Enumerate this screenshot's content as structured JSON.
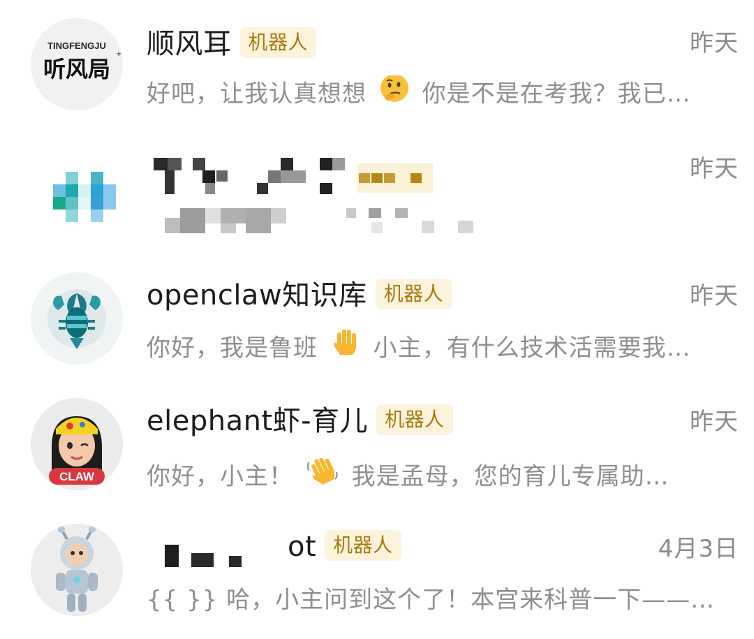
{
  "chats": [
    {
      "name": "顺风耳",
      "badge": "机器人",
      "time": "昨天",
      "preview_before": "好吧，让我认真想想",
      "preview_emoji": "thinking-face-icon",
      "preview_after": "你是不是在考我？我已…",
      "avatar": {
        "kind": "logo",
        "top_text": "TINGFENGJU",
        "main_text": "听风局"
      }
    },
    {
      "name": "",
      "badge": "",
      "time": "昨天",
      "preview_before": "",
      "preview_emoji": "",
      "preview_after": "",
      "avatar": {
        "kind": "pixelated"
      }
    },
    {
      "name": "openclaw知识库",
      "badge": "机器人",
      "time": "昨天",
      "preview_before": "你好，我是鲁班",
      "preview_emoji": "raised-hand-icon",
      "preview_after": "小主，有什么技术活需要我…",
      "avatar": {
        "kind": "lobster"
      }
    },
    {
      "name": "elephant虾-育儿",
      "badge": "机器人",
      "time": "昨天",
      "preview_before": "你好，小主！",
      "preview_emoji": "waving-hand-icon",
      "preview_after": "我是孟母，您的育儿专属助…",
      "avatar": {
        "kind": "girl",
        "label": "CLAW"
      }
    },
    {
      "name_suffix": "ot",
      "badge": "机器人",
      "time": "4月3日",
      "preview_before": "{{ }} 哈，小主问到这个了！本宫来科普一下——…",
      "avatar": {
        "kind": "robot"
      }
    }
  ],
  "colors": {
    "badge_bg": "#fbf3dc",
    "badge_text": "#a9790f",
    "secondary_text": "#8f8f8f"
  }
}
